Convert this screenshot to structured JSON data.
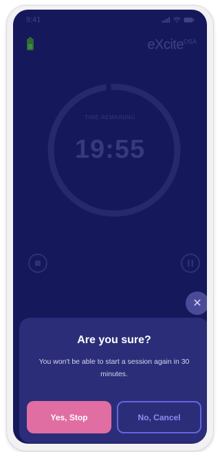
{
  "status_bar": {
    "time": "9:41",
    "icons": [
      "signal-icon",
      "wifi-icon",
      "battery-icon"
    ]
  },
  "header": {
    "battery_icon": "battery-icon",
    "brand": "eXcite",
    "brand_suffix": "OSA"
  },
  "timer": {
    "label": "TIME REMAINING",
    "value": "19:55"
  },
  "controls": {
    "stop_icon": "stop-icon",
    "pause_icon": "pause-icon"
  },
  "dialog": {
    "close_icon": "close-icon",
    "close_glyph": "✕",
    "title": "Are you sure?",
    "message": "You won't be able to start a session again in 30 minutes.",
    "confirm_label": "Yes, Stop",
    "cancel_label": "No, Cancel"
  },
  "colors": {
    "background": "#15185a",
    "dialog": "#2c2d78",
    "confirm": "#e06ea3",
    "cancel_border": "#6366e0",
    "cancel_text": "#8d8cf4"
  }
}
